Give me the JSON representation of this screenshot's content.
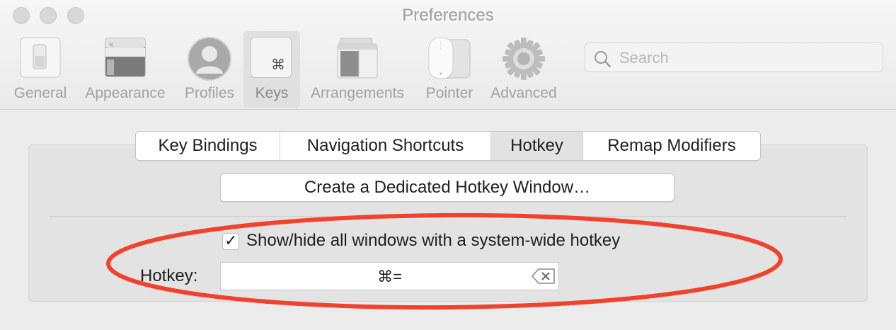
{
  "window": {
    "title": "Preferences"
  },
  "toolbar": {
    "items": [
      {
        "label": "General",
        "icon": "general-switch-icon"
      },
      {
        "label": "Appearance",
        "icon": "appearance-window-icon"
      },
      {
        "label": "Profiles",
        "icon": "profiles-person-icon"
      },
      {
        "label": "Keys",
        "icon": "keys-command-icon",
        "active": true
      },
      {
        "label": "Arrangements",
        "icon": "arrangements-windows-icon"
      },
      {
        "label": "Pointer",
        "icon": "pointer-mouse-icon"
      },
      {
        "label": "Advanced",
        "icon": "advanced-gear-icon"
      }
    ],
    "keys_glyph": "⌘"
  },
  "search": {
    "placeholder": "Search"
  },
  "tabs": {
    "items": [
      "Key Bindings",
      "Navigation Shortcuts",
      "Hotkey",
      "Remap Modifiers"
    ],
    "selected": "Hotkey"
  },
  "hotkey_window_button": "Create a Dedicated Hotkey Window…",
  "show_hide": {
    "label": "Show/hide all windows with a system-wide hotkey",
    "checked": true,
    "check_glyph": "✓"
  },
  "hotkey": {
    "label": "Hotkey:",
    "value": "⌘="
  },
  "colors": {
    "highlight": "#f0422c",
    "window_bg": "#ececec"
  }
}
